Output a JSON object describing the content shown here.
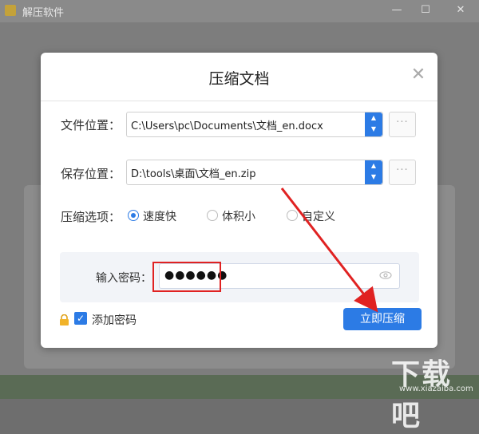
{
  "app": {
    "title": "解压软件"
  },
  "window_controls": {
    "minimize": "—",
    "maximize": "☐",
    "close": "✕"
  },
  "dialog": {
    "title": "压缩文档",
    "close_symbol": "✕",
    "file_location": {
      "label": "文件位置：",
      "value": "C:\\Users\\pc\\Documents\\文档_en.docx",
      "browse": "···"
    },
    "save_location": {
      "label": "保存位置：",
      "value": "D:\\tools\\桌面\\文档_en.zip",
      "browse": "···"
    },
    "compress_options": {
      "label": "压缩选项：",
      "options": [
        {
          "label": "速度快",
          "checked": true
        },
        {
          "label": "体积小",
          "checked": false
        },
        {
          "label": "自定义",
          "checked": false
        }
      ]
    },
    "password": {
      "label": "输入密码：",
      "value": "●●●●●●"
    },
    "add_password": {
      "label": "添加密码",
      "checked": true
    },
    "submit_button": "立即压缩"
  },
  "watermark": {
    "main": "下载吧",
    "sub": "www.xiazaiba.com"
  },
  "colors": {
    "accent": "#2c7be5",
    "annotation": "#e02222"
  }
}
